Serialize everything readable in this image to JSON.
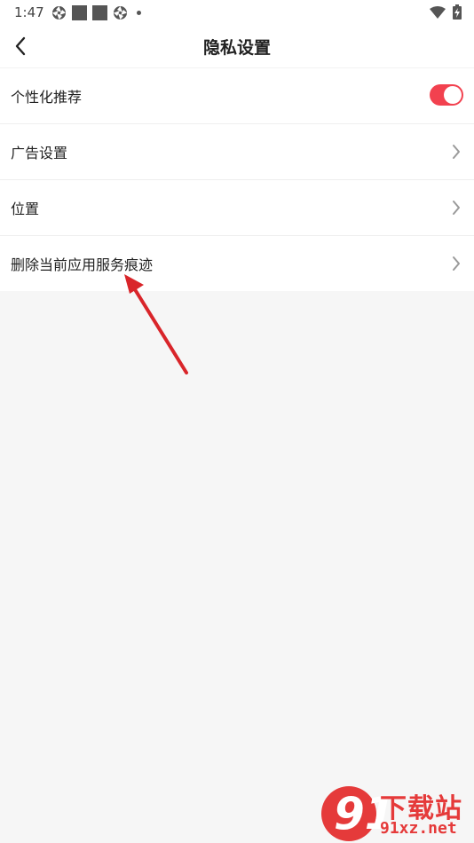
{
  "status_bar": {
    "time": "1:47",
    "icons_left": [
      "aperture-icon",
      "square-icon",
      "square-icon",
      "aperture-icon",
      "dot-icon"
    ],
    "icons_right": [
      "wifi-icon",
      "battery-charging-icon"
    ]
  },
  "nav": {
    "title": "隐私设置",
    "back_icon": "chevron-left-icon"
  },
  "settings": {
    "items": [
      {
        "label": "个性化推荐",
        "control": "toggle",
        "toggle_on": true
      },
      {
        "label": "广告设置",
        "control": "chevron"
      },
      {
        "label": "位置",
        "control": "chevron"
      },
      {
        "label": "删除当前应用服务痕迹",
        "control": "chevron"
      }
    ]
  },
  "colors": {
    "toggle_active": "#f2414f",
    "chevron": "#9a9a9a",
    "arrow": "#d9252a",
    "watermark_red": "#e53a3a"
  },
  "watermark": {
    "logo_text": "91",
    "title": "下载站",
    "url": "91xz.net"
  }
}
